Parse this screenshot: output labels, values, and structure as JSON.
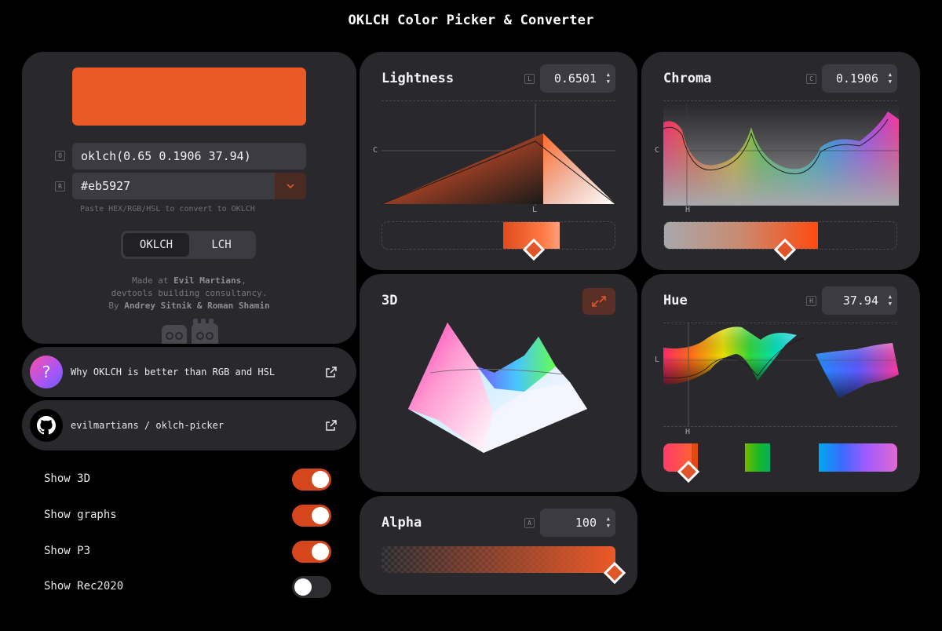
{
  "app": {
    "title": "OKLCH Color Picker & Converter"
  },
  "colors": {
    "accent": "#eb5927",
    "card_bg": "#29282c",
    "page_bg": "#000000",
    "field_bg": "#3d3b42"
  },
  "picker": {
    "oklch_letter": "O",
    "oklch_value": "oklch(0.65 0.1906 37.94)",
    "rgb_letter": "R",
    "hex_value": "#eb5927",
    "dropdown_icon": "chevron-down-icon",
    "hint": "Paste HEX/RGB/HSL to convert to OKLCH",
    "modes": [
      "OKLCH",
      "LCH"
    ],
    "selected_mode": "OKLCH",
    "credits": {
      "line1_prefix": "Made at ",
      "line1_link": "Evil Martians",
      "line1_suffix": ",",
      "line2": "devtools building consultancy.",
      "line3_prefix": "By ",
      "line3_authors": "Andrey Sitnik & Roman Shamin"
    }
  },
  "links": [
    {
      "text": "Why OKLCH is better than RGB and HSL",
      "icon": "question-icon",
      "glyph": "?"
    },
    {
      "text": "evilmartians / oklch-picker",
      "icon": "github-icon"
    }
  ],
  "toggles": [
    {
      "label": "Show 3D",
      "on": true
    },
    {
      "label": "Show graphs",
      "on": true
    },
    {
      "label": "Show P3",
      "on": true
    },
    {
      "label": "Show Rec2020",
      "on": false
    }
  ],
  "lightness": {
    "title": "Lightness",
    "letter": "L",
    "value": "0.6501",
    "axis_y": "C",
    "axis_x": "L"
  },
  "chroma": {
    "title": "Chroma",
    "letter": "C",
    "value": "0.1906",
    "axis_y": "C",
    "axis_x": "H"
  },
  "hue": {
    "title": "Hue",
    "letter": "H",
    "value": "37.94",
    "axis_y": "L",
    "axis_x": "H"
  },
  "view3d": {
    "title": "3D",
    "expand_icon": "expand-icon"
  },
  "alpha": {
    "title": "Alpha",
    "letter": "A",
    "value": "100"
  }
}
